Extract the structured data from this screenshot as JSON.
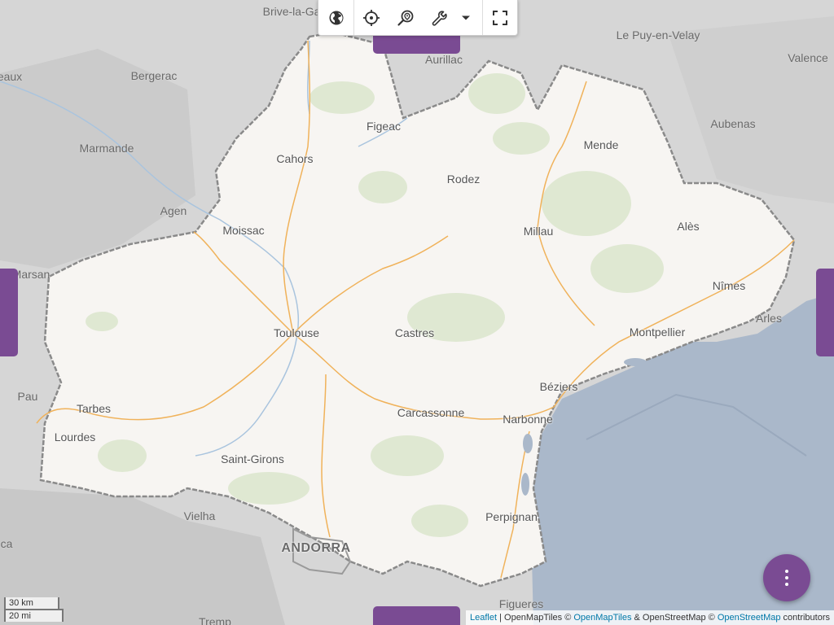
{
  "map": {
    "region_labels": [
      {
        "name": "Brive-la-Ga",
        "kind": "outside"
      },
      {
        "name": "Aurillac",
        "kind": "outside"
      },
      {
        "name": "Le Puy-en-Velay",
        "kind": "outside"
      },
      {
        "name": "Valence",
        "kind": "outside"
      },
      {
        "name": "eaux",
        "kind": "outside"
      },
      {
        "name": "Bergerac",
        "kind": "outside"
      },
      {
        "name": "Marmande",
        "kind": "outside"
      },
      {
        "name": "Agen",
        "kind": "outside"
      },
      {
        "name": "Aubenas",
        "kind": "outside"
      },
      {
        "name": "Marsan",
        "kind": "outside"
      },
      {
        "name": "Arles",
        "kind": "outside"
      },
      {
        "name": "Pau",
        "kind": "outside"
      },
      {
        "name": "Vielha",
        "kind": "outside"
      },
      {
        "name": "ca",
        "kind": "outside"
      },
      {
        "name": "Figueres",
        "kind": "outside"
      },
      {
        "name": "Tremp",
        "kind": "outside"
      },
      {
        "name": "ANDORRA",
        "kind": "country"
      },
      {
        "name": "Figeac",
        "kind": "inside"
      },
      {
        "name": "Cahors",
        "kind": "inside"
      },
      {
        "name": "Mende",
        "kind": "inside"
      },
      {
        "name": "Rodez",
        "kind": "inside"
      },
      {
        "name": "Moissac",
        "kind": "inside"
      },
      {
        "name": "Millau",
        "kind": "inside"
      },
      {
        "name": "Alès",
        "kind": "inside"
      },
      {
        "name": "Nîmes",
        "kind": "inside"
      },
      {
        "name": "Toulouse",
        "kind": "inside"
      },
      {
        "name": "Castres",
        "kind": "inside"
      },
      {
        "name": "Montpellier",
        "kind": "inside"
      },
      {
        "name": "Béziers",
        "kind": "inside"
      },
      {
        "name": "Tarbes",
        "kind": "inside"
      },
      {
        "name": "Carcassonne",
        "kind": "inside"
      },
      {
        "name": "Narbonne",
        "kind": "inside"
      },
      {
        "name": "Lourdes",
        "kind": "inside"
      },
      {
        "name": "Saint-Girons",
        "kind": "inside"
      },
      {
        "name": "Perpignan",
        "kind": "inside"
      }
    ]
  },
  "toolbar": {
    "buttons": [
      {
        "icon": "globe-icon"
      },
      {
        "icon": "crosshair-icon"
      },
      {
        "icon": "search-location-icon"
      },
      {
        "icon": "wrench-icon"
      },
      {
        "icon": "caret-down-icon"
      },
      {
        "icon": "fullscreen-icon"
      }
    ]
  },
  "scale": {
    "metric": "30 km",
    "imperial": "20 mi"
  },
  "attribution": {
    "leaflet": "Leaflet",
    "sep1": " | OpenMapTiles © ",
    "openmaptiles": "OpenMapTiles",
    "sep2": " & OpenStreetMap © ",
    "osm": "OpenStreetMap",
    "tail": " contributors"
  },
  "fab": {
    "icon": "more-vertical-icon"
  },
  "colors": {
    "accent": "#7a4b93",
    "land": "#f7f5f2",
    "outside": "#d6d6d6",
    "sea": "#aab8ca",
    "road": "#f0b25a"
  }
}
